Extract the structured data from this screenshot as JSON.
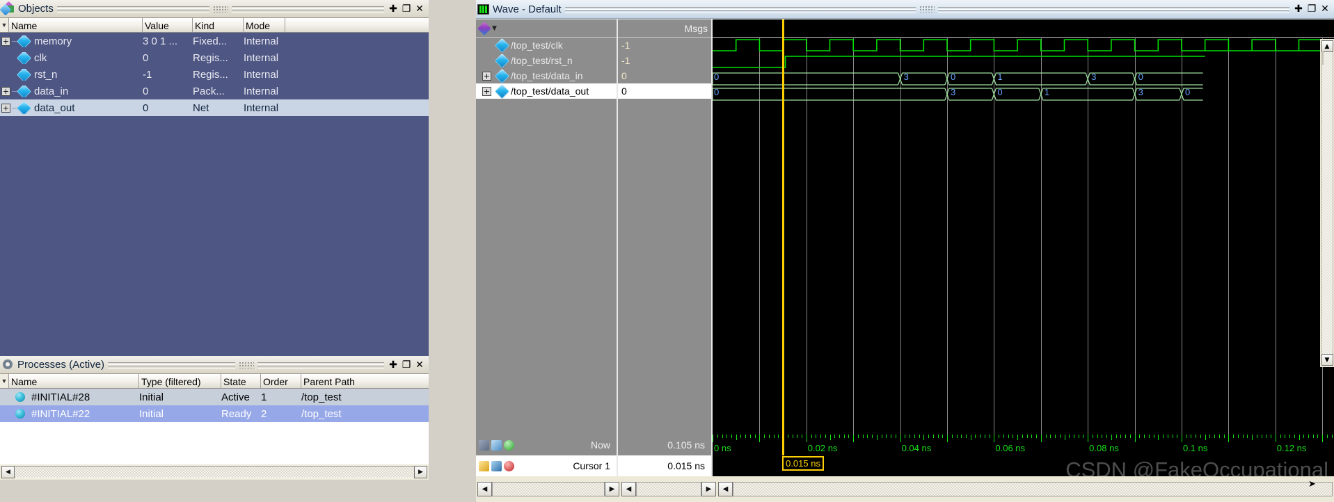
{
  "objects_panel": {
    "title": "Objects",
    "icon": "objects-icon",
    "buttons": [
      {
        "name": "dock-button",
        "glyph": "✚"
      },
      {
        "name": "undock-button",
        "glyph": "❐"
      },
      {
        "name": "close-button",
        "glyph": "✕"
      }
    ],
    "columns": [
      {
        "key": "name",
        "label": "Name"
      },
      {
        "key": "value",
        "label": "Value"
      },
      {
        "key": "kind",
        "label": "Kind"
      },
      {
        "key": "mode",
        "label": "Mode"
      }
    ],
    "rows": [
      {
        "expander": "+",
        "name": "memory",
        "value": "3 0 1 ...",
        "kind": "Fixed...",
        "mode": "Internal",
        "selected": false
      },
      {
        "expander": "",
        "name": "clk",
        "value": "0",
        "kind": "Regis...",
        "mode": "Internal",
        "selected": false
      },
      {
        "expander": "",
        "name": "rst_n",
        "value": "-1",
        "kind": "Regis...",
        "mode": "Internal",
        "selected": false
      },
      {
        "expander": "+",
        "name": "data_in",
        "value": "0",
        "kind": "Pack... ",
        "mode": "Internal",
        "selected": false
      },
      {
        "expander": "+",
        "name": "data_out",
        "value": "0",
        "kind": "Net",
        "mode": "Internal",
        "selected": true
      }
    ]
  },
  "processes_panel": {
    "title": "Processes (Active)",
    "icon": "gear-icon",
    "buttons": [
      {
        "name": "dock-button",
        "glyph": "✚"
      },
      {
        "name": "undock-button",
        "glyph": "❐"
      },
      {
        "name": "close-button",
        "glyph": "✕"
      }
    ],
    "columns": [
      {
        "key": "name",
        "label": "Name"
      },
      {
        "key": "type",
        "label": "Type (filtered)"
      },
      {
        "key": "state",
        "label": "State"
      },
      {
        "key": "order",
        "label": "Order"
      },
      {
        "key": "parent",
        "label": "Parent Path"
      }
    ],
    "rows": [
      {
        "name": "#INITIAL#28",
        "type": "Initial",
        "state": "Active",
        "order": "1",
        "parent": "/top_test",
        "highlight": "light"
      },
      {
        "name": "#INITIAL#22",
        "type": "Initial",
        "state": "Ready",
        "order": "2",
        "parent": "/top_test",
        "highlight": "blue"
      }
    ]
  },
  "wave_panel": {
    "title": "Wave - Default",
    "icon": "wave-icon",
    "buttons": [
      {
        "name": "dock-button",
        "glyph": "✚"
      },
      {
        "name": "undock-button",
        "glyph": "❐"
      },
      {
        "name": "close-button",
        "glyph": "✕"
      }
    ],
    "msgs_header": "Msgs",
    "signals": [
      {
        "expander": "",
        "name": "/top_test/clk",
        "value": "-1",
        "selected": false
      },
      {
        "expander": "",
        "name": "/top_test/rst_n",
        "value": "-1",
        "selected": false
      },
      {
        "expander": "+",
        "name": "/top_test/data_in",
        "value": "0",
        "selected": false
      },
      {
        "expander": "+",
        "name": "/top_test/data_out",
        "value": "0",
        "selected": true
      }
    ],
    "now": {
      "label": "Now",
      "value": "0.105 ns"
    },
    "cursor": {
      "label": "Cursor 1",
      "value": "0.015 ns",
      "flag": "0.015 ns"
    },
    "time_axis": {
      "unit": "ns",
      "ticks": [
        {
          "label": "0 ns",
          "time": 0.0
        },
        {
          "label": "0.02 ns",
          "time": 0.02
        },
        {
          "label": "0.04 ns",
          "time": 0.04
        },
        {
          "label": "0.06 ns",
          "time": 0.06
        },
        {
          "label": "0.08 ns",
          "time": 0.08
        },
        {
          "label": "0.1 ns",
          "time": 0.1
        },
        {
          "label": "0.12 ns",
          "time": 0.12
        }
      ],
      "range": [
        0.0,
        0.1325
      ]
    },
    "bus_transitions": {
      "data_in": [
        {
          "time": 0.0,
          "value": "0"
        },
        {
          "time": 0.04,
          "value": "3"
        },
        {
          "time": 0.05,
          "value": "0"
        },
        {
          "time": 0.06,
          "value": "1"
        },
        {
          "time": 0.08,
          "value": "3"
        },
        {
          "time": 0.09,
          "value": "0"
        }
      ],
      "data_out": [
        {
          "time": 0.0,
          "value": "0"
        },
        {
          "time": 0.05,
          "value": "3"
        },
        {
          "time": 0.06,
          "value": "0"
        },
        {
          "time": 0.07,
          "value": "1"
        },
        {
          "time": 0.09,
          "value": "3"
        },
        {
          "time": 0.1,
          "value": "0"
        }
      ]
    },
    "colors": {
      "wave_green": "#00e000",
      "bus_green": "#9fe09f",
      "cursor_yellow": "#ffd000",
      "background": "#000000",
      "grid": "#8a8a8a"
    }
  },
  "watermark": "CSDN @FakeOccupational"
}
